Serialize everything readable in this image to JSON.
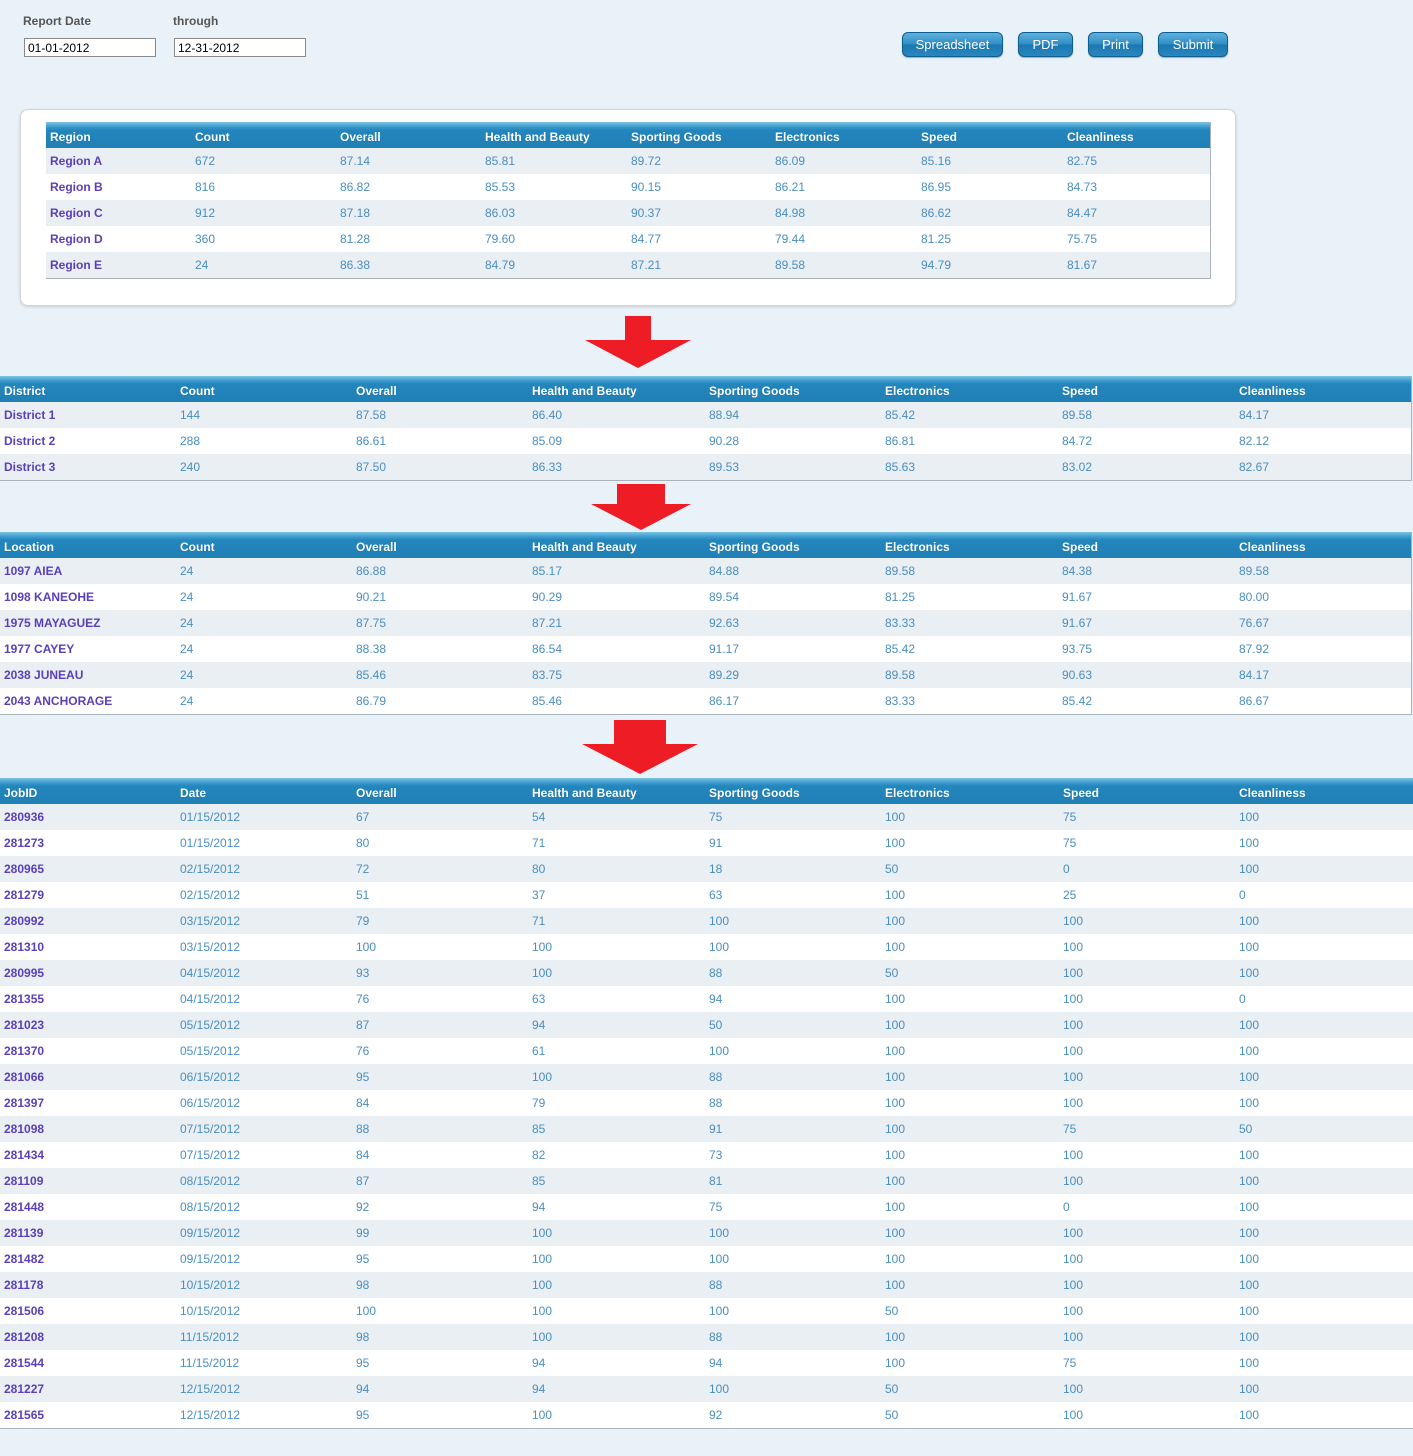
{
  "filters": {
    "report_date_label": "Report Date",
    "through_label": "through",
    "start_date": "01-01-2012",
    "end_date": "12-31-2012"
  },
  "toolbar": {
    "spreadsheet": "Spreadsheet",
    "pdf": "PDF",
    "print": "Print",
    "submit": "Submit"
  },
  "colors": {
    "header": "#1f80b6",
    "link": "#5b3fb8",
    "value": "#4a8ec0",
    "arrow": "#ee1c24"
  },
  "region_table": {
    "headers": [
      "Region",
      "Count",
      "Overall",
      "Health and Beauty",
      "Sporting Goods",
      "Electronics",
      "Speed",
      "Cleanliness"
    ],
    "rows": [
      [
        "Region A",
        "672",
        "87.14",
        "85.81",
        "89.72",
        "86.09",
        "85.16",
        "82.75"
      ],
      [
        "Region B",
        "816",
        "86.82",
        "85.53",
        "90.15",
        "86.21",
        "86.95",
        "84.73"
      ],
      [
        "Region C",
        "912",
        "87.18",
        "86.03",
        "90.37",
        "84.98",
        "86.62",
        "84.47"
      ],
      [
        "Region D",
        "360",
        "81.28",
        "79.60",
        "84.77",
        "79.44",
        "81.25",
        "75.75"
      ],
      [
        "Region E",
        "24",
        "86.38",
        "84.79",
        "87.21",
        "89.58",
        "94.79",
        "81.67"
      ]
    ]
  },
  "district_table": {
    "headers": [
      "District",
      "Count",
      "Overall",
      "Health and Beauty",
      "Sporting Goods",
      "Electronics",
      "Speed",
      "Cleanliness"
    ],
    "rows": [
      [
        "District 1",
        "144",
        "87.58",
        "86.40",
        "88.94",
        "85.42",
        "89.58",
        "84.17"
      ],
      [
        "District 2",
        "288",
        "86.61",
        "85.09",
        "90.28",
        "86.81",
        "84.72",
        "82.12"
      ],
      [
        "District 3",
        "240",
        "87.50",
        "86.33",
        "89.53",
        "85.63",
        "83.02",
        "82.67"
      ]
    ]
  },
  "location_table": {
    "headers": [
      "Location",
      "Count",
      "Overall",
      "Health and Beauty",
      "Sporting Goods",
      "Electronics",
      "Speed",
      "Cleanliness"
    ],
    "rows": [
      [
        "1097 AIEA",
        "24",
        "86.88",
        "85.17",
        "84.88",
        "89.58",
        "84.38",
        "89.58"
      ],
      [
        "1098 KANEOHE",
        "24",
        "90.21",
        "90.29",
        "89.54",
        "81.25",
        "91.67",
        "80.00"
      ],
      [
        "1975 MAYAGUEZ",
        "24",
        "87.75",
        "87.21",
        "92.63",
        "83.33",
        "91.67",
        "76.67"
      ],
      [
        "1977 CAYEY",
        "24",
        "88.38",
        "86.54",
        "91.17",
        "85.42",
        "93.75",
        "87.92"
      ],
      [
        "2038 JUNEAU",
        "24",
        "85.46",
        "83.75",
        "89.29",
        "89.58",
        "90.63",
        "84.17"
      ],
      [
        "2043 ANCHORAGE",
        "24",
        "86.79",
        "85.46",
        "86.17",
        "83.33",
        "85.42",
        "86.67"
      ]
    ]
  },
  "job_table": {
    "headers": [
      "JobID",
      "Date",
      "Overall",
      "Health and Beauty",
      "Sporting Goods",
      "Electronics",
      "Speed",
      "Cleanliness"
    ],
    "rows": [
      [
        "280936",
        "01/15/2012",
        "67",
        "54",
        "75",
        "100",
        "75",
        "100"
      ],
      [
        "281273",
        "01/15/2012",
        "80",
        "71",
        "91",
        "100",
        "75",
        "100"
      ],
      [
        "280965",
        "02/15/2012",
        "72",
        "80",
        "18",
        "50",
        "0",
        "100"
      ],
      [
        "281279",
        "02/15/2012",
        "51",
        "37",
        "63",
        "100",
        "25",
        "0"
      ],
      [
        "280992",
        "03/15/2012",
        "79",
        "71",
        "100",
        "100",
        "100",
        "100"
      ],
      [
        "281310",
        "03/15/2012",
        "100",
        "100",
        "100",
        "100",
        "100",
        "100"
      ],
      [
        "280995",
        "04/15/2012",
        "93",
        "100",
        "88",
        "50",
        "100",
        "100"
      ],
      [
        "281355",
        "04/15/2012",
        "76",
        "63",
        "94",
        "100",
        "100",
        "0"
      ],
      [
        "281023",
        "05/15/2012",
        "87",
        "94",
        "50",
        "100",
        "100",
        "100"
      ],
      [
        "281370",
        "05/15/2012",
        "76",
        "61",
        "100",
        "100",
        "100",
        "100"
      ],
      [
        "281066",
        "06/15/2012",
        "95",
        "100",
        "88",
        "100",
        "100",
        "100"
      ],
      [
        "281397",
        "06/15/2012",
        "84",
        "79",
        "88",
        "100",
        "100",
        "100"
      ],
      [
        "281098",
        "07/15/2012",
        "88",
        "85",
        "91",
        "100",
        "75",
        "50"
      ],
      [
        "281434",
        "07/15/2012",
        "84",
        "82",
        "73",
        "100",
        "100",
        "100"
      ],
      [
        "281109",
        "08/15/2012",
        "87",
        "85",
        "81",
        "100",
        "100",
        "100"
      ],
      [
        "281448",
        "08/15/2012",
        "92",
        "94",
        "75",
        "100",
        "0",
        "100"
      ],
      [
        "281139",
        "09/15/2012",
        "99",
        "100",
        "100",
        "100",
        "100",
        "100"
      ],
      [
        "281482",
        "09/15/2012",
        "95",
        "100",
        "100",
        "100",
        "100",
        "100"
      ],
      [
        "281178",
        "10/15/2012",
        "98",
        "100",
        "88",
        "100",
        "100",
        "100"
      ],
      [
        "281506",
        "10/15/2012",
        "100",
        "100",
        "100",
        "50",
        "100",
        "100"
      ],
      [
        "281208",
        "11/15/2012",
        "98",
        "100",
        "88",
        "100",
        "100",
        "100"
      ],
      [
        "281544",
        "11/15/2012",
        "95",
        "94",
        "94",
        "100",
        "75",
        "100"
      ],
      [
        "281227",
        "12/15/2012",
        "94",
        "94",
        "100",
        "50",
        "100",
        "100"
      ],
      [
        "281565",
        "12/15/2012",
        "95",
        "100",
        "92",
        "50",
        "100",
        "100"
      ]
    ]
  }
}
